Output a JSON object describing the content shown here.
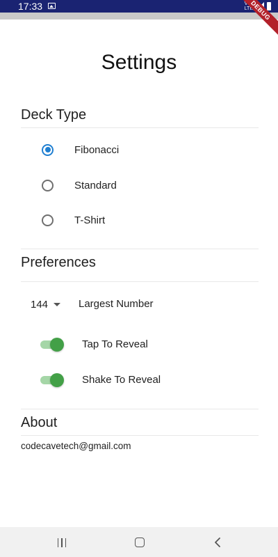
{
  "status_bar": {
    "time": "17:33",
    "network_label": "Vo)\nLTE"
  },
  "debug_banner": "DEBUG",
  "page": {
    "title": "Settings"
  },
  "deck_type": {
    "title": "Deck Type",
    "options": [
      {
        "label": "Fibonacci",
        "selected": true
      },
      {
        "label": "Standard",
        "selected": false
      },
      {
        "label": "T-Shirt",
        "selected": false
      }
    ]
  },
  "preferences": {
    "title": "Preferences",
    "largest_number": {
      "value": "144",
      "label": "Largest Number"
    },
    "toggles": [
      {
        "label": "Tap To Reveal",
        "on": true
      },
      {
        "label": "Shake To Reveal",
        "on": true
      }
    ]
  },
  "about": {
    "title": "About",
    "email": "codecavetech@gmail.com"
  },
  "colors": {
    "status_bar": "#1a2372",
    "radio_selected": "#1f7fd1",
    "switch_on": "#43a047",
    "switch_track": "#a5d6a7"
  },
  "nav_bar": {
    "icons": [
      "recents-icon",
      "home-icon",
      "back-icon"
    ]
  }
}
